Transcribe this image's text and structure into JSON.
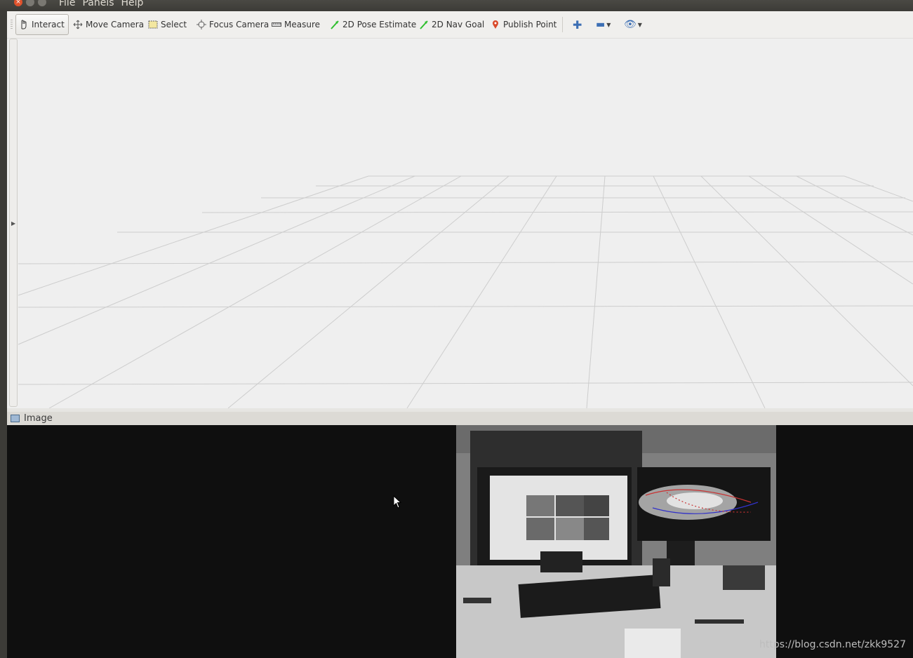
{
  "window": {
    "menus": [
      "File",
      "Panels",
      "Help"
    ]
  },
  "toolbar": {
    "tools": [
      {
        "label": "Interact",
        "icon": "hand-icon"
      },
      {
        "label": "Move Camera",
        "icon": "move-camera-icon"
      },
      {
        "label": "Select",
        "icon": "select-box-icon"
      },
      {
        "label": "Focus Camera",
        "icon": "focus-crosshair-icon"
      },
      {
        "label": "Measure",
        "icon": "ruler-icon"
      },
      {
        "label": "2D Pose Estimate",
        "icon": "green-arrow-icon"
      },
      {
        "label": "2D Nav Goal",
        "icon": "green-arrow-icon"
      },
      {
        "label": "Publish Point",
        "icon": "map-pin-icon"
      }
    ],
    "colors": {
      "accent": "#3d6fb4",
      "arrow_green": "#2fbf2f",
      "pin": "#d94a2b"
    }
  },
  "image_panel": {
    "title": "Image"
  },
  "watermark": "https://blog.csdn.net/zkk9527"
}
